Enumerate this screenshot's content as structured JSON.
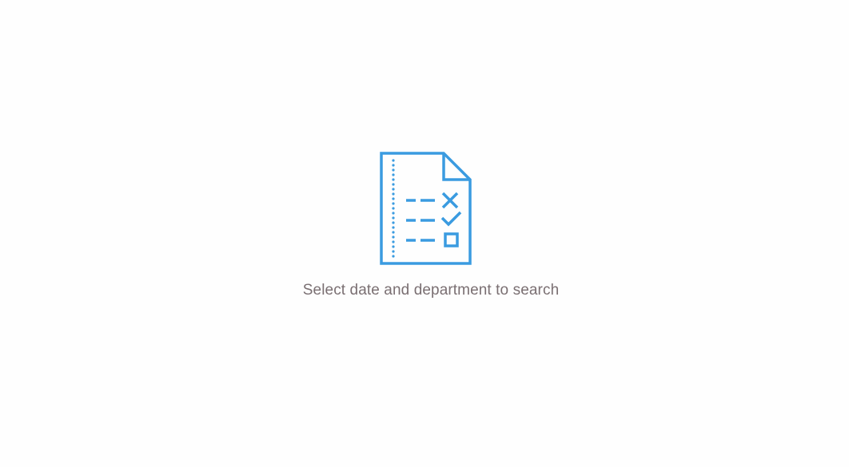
{
  "empty_state": {
    "icon": "checklist-document-icon",
    "accent_color": "#3a9be0",
    "message": "Select date and department to search",
    "message_color": "#7a6f72"
  }
}
